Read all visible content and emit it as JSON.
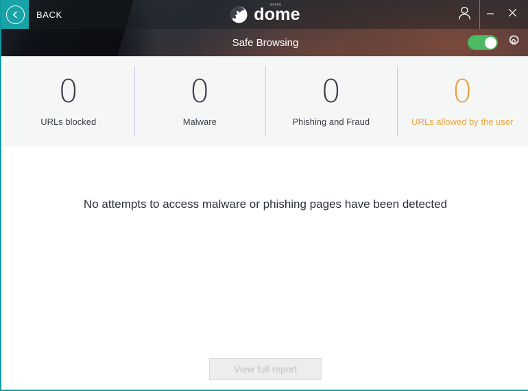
{
  "window": {
    "accent_teal": "#17a3a8",
    "titlebar": {
      "back_label": "BACK",
      "back_icon": "chevron-left-circle-icon",
      "brand_name": "dome",
      "brand_superscript": "panda",
      "brand_icon": "panda-head-icon",
      "user_icon": "user-account-icon",
      "minimize_label": "–",
      "close_label": "✕"
    },
    "subbar": {
      "title": "Safe Browsing",
      "toggle_state": "on",
      "toggle_color": "#4cb963",
      "settings_icon": "gear-icon"
    }
  },
  "stats": {
    "items": [
      {
        "value": "0",
        "label": "URLs blocked",
        "accent": false
      },
      {
        "value": "0",
        "label": "Malware",
        "accent": false
      },
      {
        "value": "0",
        "label": "Phishing and Fraud",
        "accent": false
      },
      {
        "value": "0",
        "label": "URLs allowed by the user",
        "accent": true
      }
    ],
    "accent_color": "#e8a33d"
  },
  "main": {
    "empty_message": "No attempts to access malware or phishing pages have been detected",
    "report_button_label": "View full report",
    "report_button_enabled": false
  }
}
